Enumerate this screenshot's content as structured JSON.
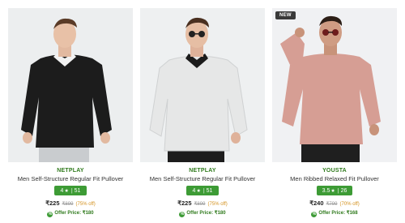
{
  "products": [
    {
      "brand": "NETPLAY",
      "title": "Men Self-Structure Regular Fit Pullover",
      "rating": "4",
      "reviews": "51",
      "price": "₹225",
      "mrp": "₹899",
      "discount": "(75% off)",
      "offer": "Offer Price: ₹180",
      "colors": {
        "sweater": "#1c1c1c",
        "collar": "#f2f2f2"
      }
    },
    {
      "brand": "NETPLAY",
      "title": "Men Self-Structure Regular Fit Pullover",
      "rating": "4",
      "reviews": "51",
      "price": "₹225",
      "mrp": "₹899",
      "discount": "(75% off)",
      "offer": "Offer Price: ₹180",
      "colors": {
        "sweater": "#e9eaea",
        "collar": "#1b1b1b"
      }
    },
    {
      "badge": "NEW",
      "brand": "YOUSTA",
      "title": "Men Ribbed Relaxed Fit Pullover",
      "rating": "3.5",
      "reviews": "26",
      "price": "₹240",
      "mrp": "₹799",
      "discount": "(70% off)",
      "offer": "Offer Price: ₹168",
      "colors": {
        "sweater": "#d69e94",
        "collar": "#d69e94"
      }
    }
  ],
  "icons": {
    "rating_star": "star-icon",
    "offer": "tag-icon"
  },
  "theme": {
    "brand_green": "#2f7a1c",
    "rating_green": "#3d9b35",
    "discount_orange": "#d3901b"
  }
}
